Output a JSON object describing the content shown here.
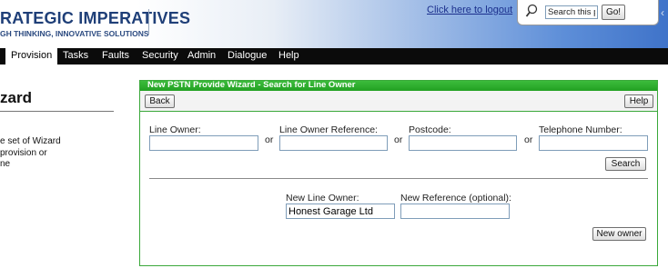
{
  "header": {
    "brand_title": "RATEGIC IMPERATIVES",
    "brand_tagline": "GH THINKING, INNOVATIVE SOLUTIONS",
    "logout_link": "Click here to logout",
    "search": {
      "placeholder": "Search this portal...",
      "go_label": "Go!"
    }
  },
  "nav": {
    "items": [
      {
        "label": "Provision",
        "active": true
      },
      {
        "label": "Tasks"
      },
      {
        "label": "Faults"
      },
      {
        "label": "Security"
      },
      {
        "label": "Admin"
      },
      {
        "label": "Dialogue"
      },
      {
        "label": "Help"
      }
    ]
  },
  "left_panel": {
    "title": "zard",
    "desc_lines": [
      "e set of Wizard",
      "provision or",
      "ne"
    ]
  },
  "wizard": {
    "title": "New PSTN Provide Wizard - Search for Line Owner",
    "back_label": "Back",
    "help_label": "Help",
    "search_fields": {
      "line_owner_label": "Line Owner:",
      "line_owner_value": "",
      "reference_label": "Line Owner Reference:",
      "reference_value": "",
      "postcode_label": "Postcode:",
      "postcode_value": "",
      "telephone_label": "Telephone Number:",
      "telephone_value": "",
      "or_text": "or"
    },
    "search_button": "Search",
    "new_owner": {
      "line_owner_label": "New Line Owner:",
      "line_owner_value": "Honest Garage Ltd",
      "reference_label": "New Reference (optional):",
      "reference_value": ""
    },
    "new_owner_button": "New owner"
  },
  "colors": {
    "brand": "#1f3f78",
    "header_blue": "#3f73c9",
    "nav_bg": "#0b0b0b",
    "wizard_green": "#3aa83a"
  },
  "icons": [
    "search-icon",
    "chevron-left-icon"
  ]
}
